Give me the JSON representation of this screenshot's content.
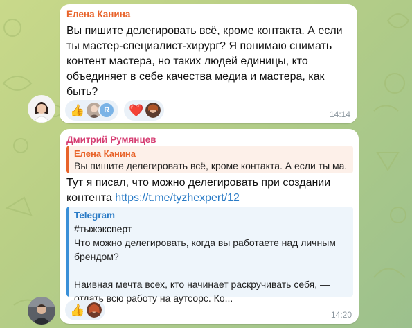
{
  "messages": [
    {
      "sender": "Елена Канина",
      "sender_color": "#e8632a",
      "lines": [
        "Вы пишите делегировать всё, кроме контакта. А если",
        "ты мастер-специалист-хирург? Я понимаю снимать",
        "контент мастера, но таких людей единицы, кто",
        "объединяет в себе качества медиа и мастера, как",
        "быть?"
      ],
      "reactions": [
        {
          "emoji": "👍",
          "count_badge": "R"
        },
        {
          "emoji": "❤️"
        }
      ],
      "time": "14:14"
    },
    {
      "sender": "Дмитрий Румянцев",
      "sender_color": "#d63e73",
      "quote": {
        "author": "Елена Канина",
        "text": "Вы пишите делегировать всё, кроме контакта. А если ты ма..."
      },
      "lines": [
        "Тут я писал, что можно делегировать при создании",
        "контента "
      ],
      "link": "https://t.me/tyzhexpert/12",
      "preview": {
        "site": "Telegram",
        "title": "#тыжэксперт",
        "desc_lines": [
          "Что можно делегировать, когда вы работаете над личным",
          "брендом?",
          "",
          "Наивная мечта всех, кто начинает раскручивать себя, —",
          "отдать всю работу на аутсорс. Ко..."
        ]
      },
      "reactions": [
        {
          "emoji": "👍"
        }
      ],
      "time": "14:20"
    }
  ]
}
